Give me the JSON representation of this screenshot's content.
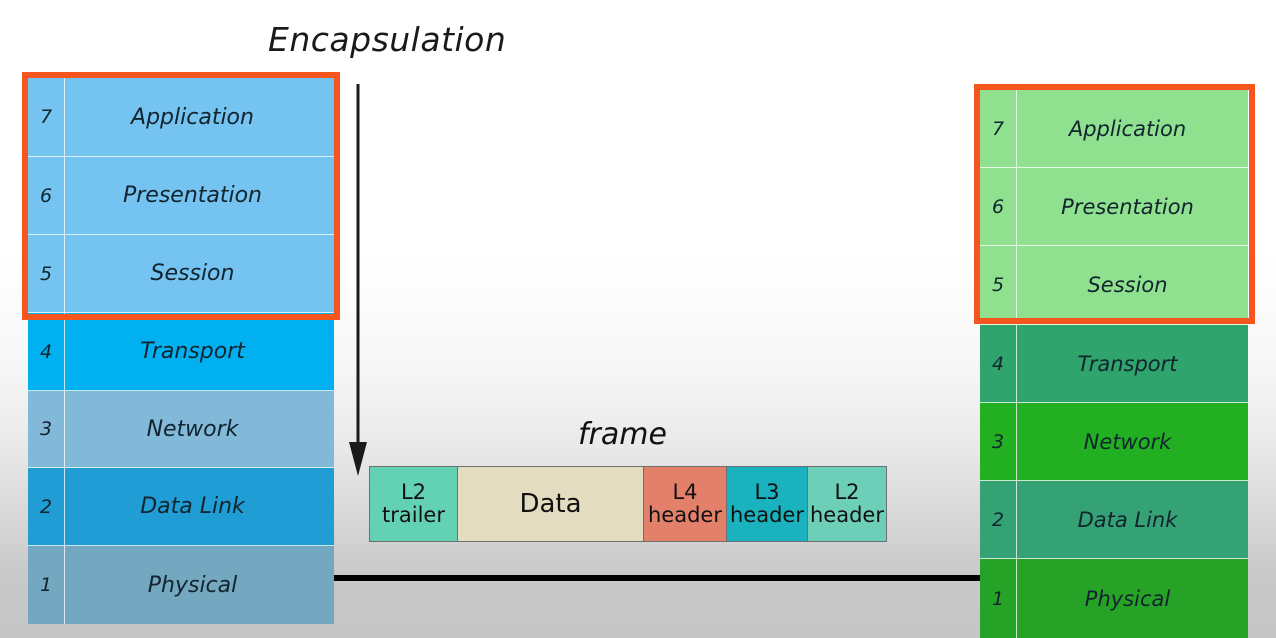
{
  "title": "Encapsulation",
  "colors": {
    "highlight_border": "#f4561e",
    "arrow": "#1a1a1a",
    "medium_line": "#000000",
    "background_top": "#ffffff",
    "background_bottom": "#c6c6c6"
  },
  "left_stack": {
    "name": "sender-osi-stack",
    "highlight_layers": [
      7,
      6,
      5
    ],
    "layers": [
      {
        "num": "7",
        "label": "Application",
        "color": "#74c3f0"
      },
      {
        "num": "6",
        "label": "Presentation",
        "color": "#74c3f0"
      },
      {
        "num": "5",
        "label": "Session",
        "color": "#74c3f0"
      },
      {
        "num": "4",
        "label": "Transport",
        "color": "#00b0f0"
      },
      {
        "num": "3",
        "label": "Network",
        "color": "#82b8d8"
      },
      {
        "num": "2",
        "label": "Data Link",
        "color": "#1f9dd4"
      },
      {
        "num": "1",
        "label": "Physical",
        "color": "#74a7c0"
      }
    ]
  },
  "right_stack": {
    "name": "receiver-osi-stack",
    "highlight_layers": [
      7,
      6,
      5
    ],
    "layers": [
      {
        "num": "7",
        "label": "Application",
        "color": "#8fe08f"
      },
      {
        "num": "6",
        "label": "Presentation",
        "color": "#8fe08f"
      },
      {
        "num": "5",
        "label": "Session",
        "color": "#8fe08f"
      },
      {
        "num": "4",
        "label": "Transport",
        "color": "#2fa46c"
      },
      {
        "num": "3",
        "label": "Network",
        "color": "#22b022"
      },
      {
        "num": "2",
        "label": "Data Link",
        "color": "#35a276"
      },
      {
        "num": "1",
        "label": "Physical",
        "color": "#26a326"
      }
    ]
  },
  "frame": {
    "label": "frame",
    "cells": [
      {
        "line1": "L2",
        "line2": "trailer",
        "color": "#63d1b4"
      },
      {
        "line1": "Data",
        "line2": "",
        "color": "#e3dcc0"
      },
      {
        "line1": "L4",
        "line2": "header",
        "color": "#e2806a"
      },
      {
        "line1": "L3",
        "line2": "header",
        "color": "#19b2be"
      },
      {
        "line1": "L2",
        "line2": "header",
        "color": "#6dcfb8"
      }
    ]
  }
}
